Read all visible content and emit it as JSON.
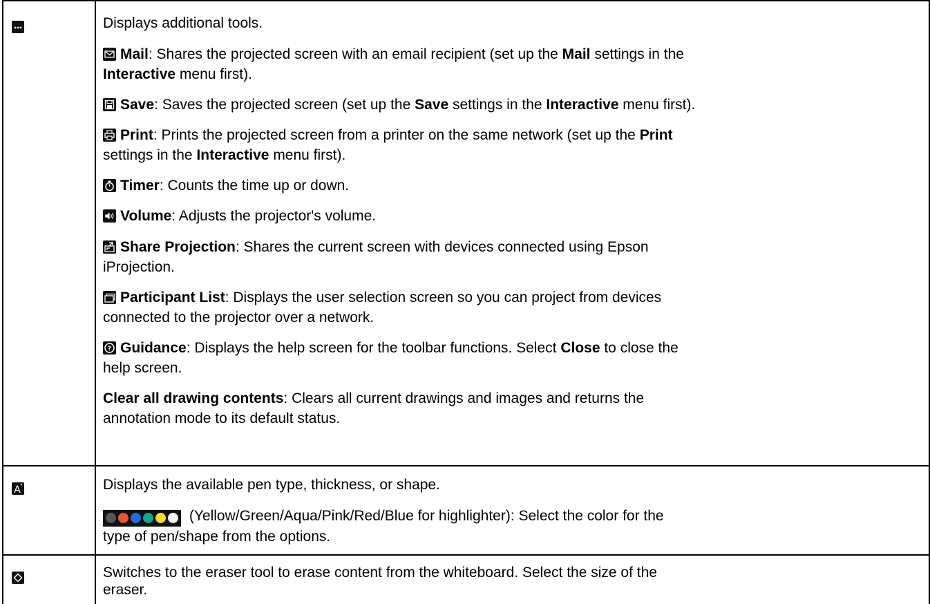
{
  "rows": [
    {
      "icon": "more-tools-icon",
      "paras": [
        {
          "plain": "Displays additional tools."
        },
        {
          "icon": "mail-icon",
          "label": "Mail",
          "text1": ": Shares the projected screen with an email recipient (set up the ",
          "b1": "Mail",
          "text2": " settings in the",
          "line2_b": "Interactive",
          "line2_t": " menu first)."
        },
        {
          "icon": "save-icon",
          "label": "Save",
          "text1": ": Saves the projected screen (set up the ",
          "b1": "Save",
          "text2": " settings in the ",
          "b2": "Interactive",
          "text3": " menu first)."
        },
        {
          "icon": "print-icon",
          "label": "Print",
          "text1": ": Prints the projected screen from a printer on the same network (set up the ",
          "b1": "Print",
          "line2_t1": "settings in the ",
          "line2_b": "Interactive",
          "line2_t2": " menu first)."
        },
        {
          "icon": "timer-icon",
          "label": "Timer",
          "text1": ": Counts the time up or down."
        },
        {
          "icon": "volume-icon",
          "label": "Volume",
          "text1": ": Adjusts the projector's volume."
        },
        {
          "icon": "share-projection-icon",
          "label": "Share Projection",
          "text1": ": Shares the current screen with devices connected using Epson",
          "line2": "iProjection."
        },
        {
          "icon": "participant-list-icon",
          "label": "Participant List",
          "text1": ": Displays the user selection screen so you can project from devices",
          "line2": "connected to the projector over a network."
        },
        {
          "icon": "guidance-icon",
          "label": "Guidance",
          "text1": ": Displays the help screen for the toolbar functions. Select ",
          "b1": "Close",
          "text2": " to close the",
          "line2": "help screen."
        },
        {
          "label": "Clear all drawing contents",
          "text1": ": Clears all current drawings and images and returns the",
          "line2": "annotation mode to its default status."
        }
      ]
    },
    {
      "icon": "pen-type-icon",
      "paras": [
        {
          "plain": "Displays the available pen type, thickness, or shape."
        },
        {
          "swatch_colors": [
            "#555555",
            "#e8553a",
            "#1e6fe0",
            "#17a589",
            "#f4e021",
            "#f2f2f2"
          ],
          "text1": " (Yellow/Green/Aqua/Pink/Red/Blue for highlighter): Select the color for the",
          "line2": "type of pen/shape from the options."
        }
      ]
    },
    {
      "icon": "eraser-icon",
      "paras": [
        {
          "plain": "Switches to the eraser tool to erase content from the whiteboard. Select the size of the",
          "line2": "eraser."
        }
      ]
    }
  ]
}
